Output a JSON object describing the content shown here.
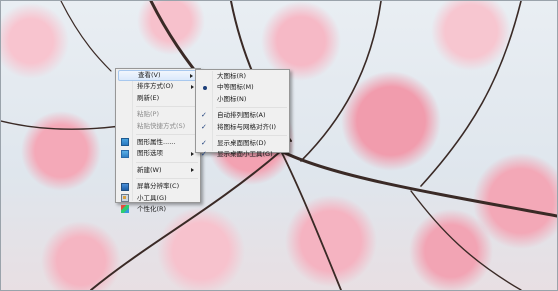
{
  "context_menu": {
    "items": [
      {
        "label": "查看(V)",
        "has_submenu": true,
        "state": "highlighted"
      },
      {
        "label": "排序方式(O)",
        "has_submenu": true
      },
      {
        "label": "刷新(E)"
      },
      {
        "label": "粘贴(P)",
        "disabled": true
      },
      {
        "label": "粘贴快捷方式(S)",
        "disabled": true
      },
      {
        "label": "图形属性......",
        "icon": "graphics-properties-icon"
      },
      {
        "label": "图形选项",
        "icon": "graphics-options-icon",
        "has_submenu": true
      },
      {
        "label": "新建(W)",
        "has_submenu": true
      },
      {
        "label": "屏幕分辨率(C)",
        "icon": "screen-resolution-icon"
      },
      {
        "label": "小工具(G)",
        "icon": "gadgets-icon"
      },
      {
        "label": "个性化(R)",
        "icon": "personalize-icon"
      }
    ]
  },
  "view_submenu": {
    "items": [
      {
        "label": "大图标(R)"
      },
      {
        "label": "中等图标(M)",
        "selected": true,
        "mark": "radio-dot"
      },
      {
        "label": "小图标(N)"
      },
      {
        "label": "自动排列图标(A)",
        "checked": true,
        "mark": "✓"
      },
      {
        "label": "将图标与网格对齐(I)",
        "checked": true,
        "mark": "✓"
      },
      {
        "label": "显示桌面图标(D)",
        "checked": true,
        "mark": "✓"
      },
      {
        "label": "显示桌面小工具(G)",
        "checked": true,
        "mark": "✓"
      }
    ]
  },
  "colors": {
    "menu_bg": "#f0f0f0",
    "highlight_border": "#a8c8ee",
    "blossom_pink": "#f4a9b8",
    "sky": "#e6ecf2"
  }
}
